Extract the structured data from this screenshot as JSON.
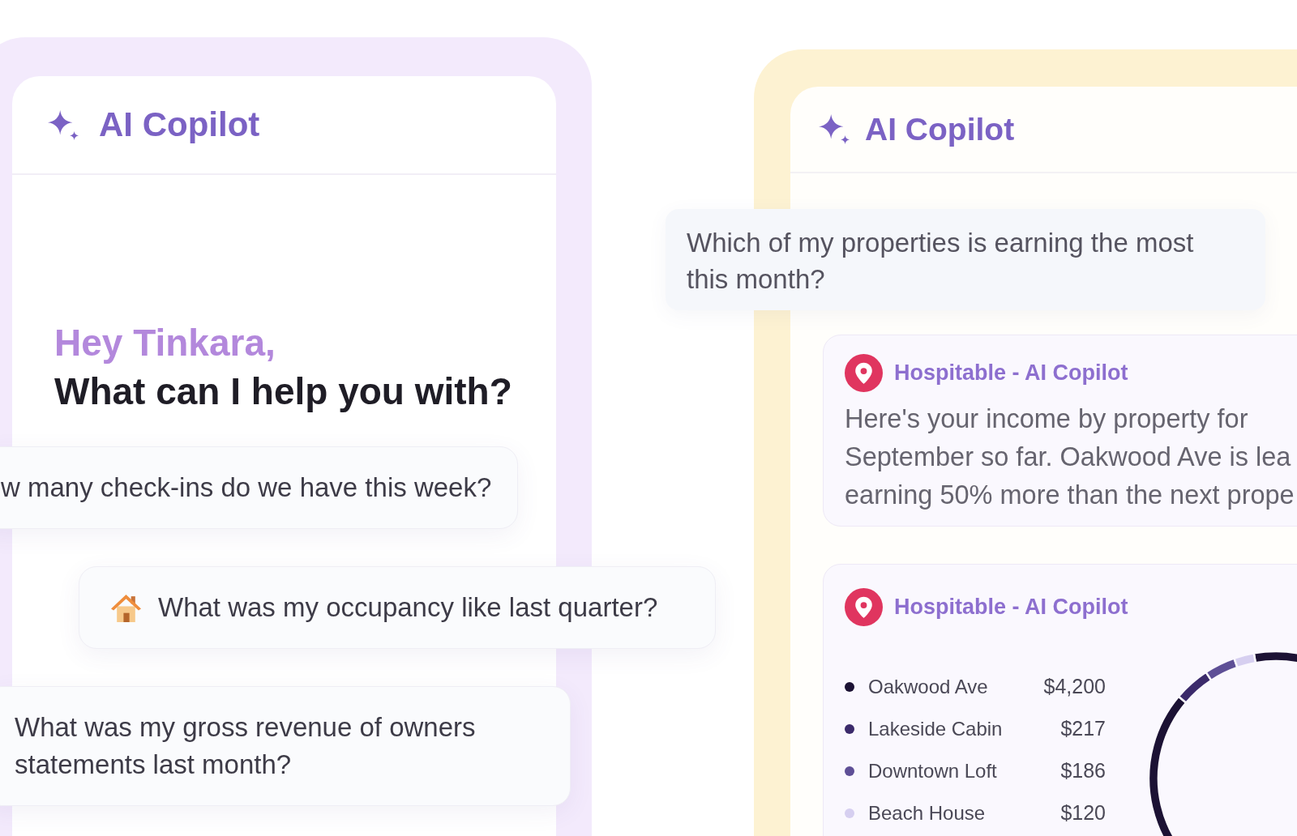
{
  "left_screen": {
    "header": {
      "title": "AI Copilot"
    },
    "greeting": "Hey Tinkara,",
    "question": "What can I help you with?"
  },
  "suggestions": [
    {
      "kind": "plain",
      "text": "w many check-ins do we have this week?"
    },
    {
      "kind": "house",
      "text": "What was my occupancy like last quarter?"
    },
    {
      "kind": "plain",
      "text": "What was my gross revenue of owners statements last month?"
    }
  ],
  "right_screen": {
    "header": {
      "title": "AI Copilot"
    },
    "user_message": "Which of my properties is earning the most this month?",
    "replies": [
      {
        "kind": "text",
        "sender": "Hospitable - AI Copilot",
        "lines": [
          "Here's your income by property for",
          "September so far. Oakwood Ave is lea",
          "earning 50% more than the next prope"
        ]
      },
      {
        "kind": "chart",
        "sender": "Hospitable - AI Copilot",
        "chart_data": {
          "type": "donut",
          "categories": [
            "Oakwood Ave",
            "Lakeside Cabin",
            "Downtown Loft",
            "Beach House"
          ],
          "values": [
            4200,
            217,
            186,
            120
          ],
          "value_labels": [
            "$4,200",
            "$217",
            "$186",
            "$120"
          ],
          "colors": [
            "#1c1234",
            "#3b2a6b",
            "#5e4f96",
            "#d6cff0"
          ],
          "legend": "left"
        }
      }
    ]
  }
}
